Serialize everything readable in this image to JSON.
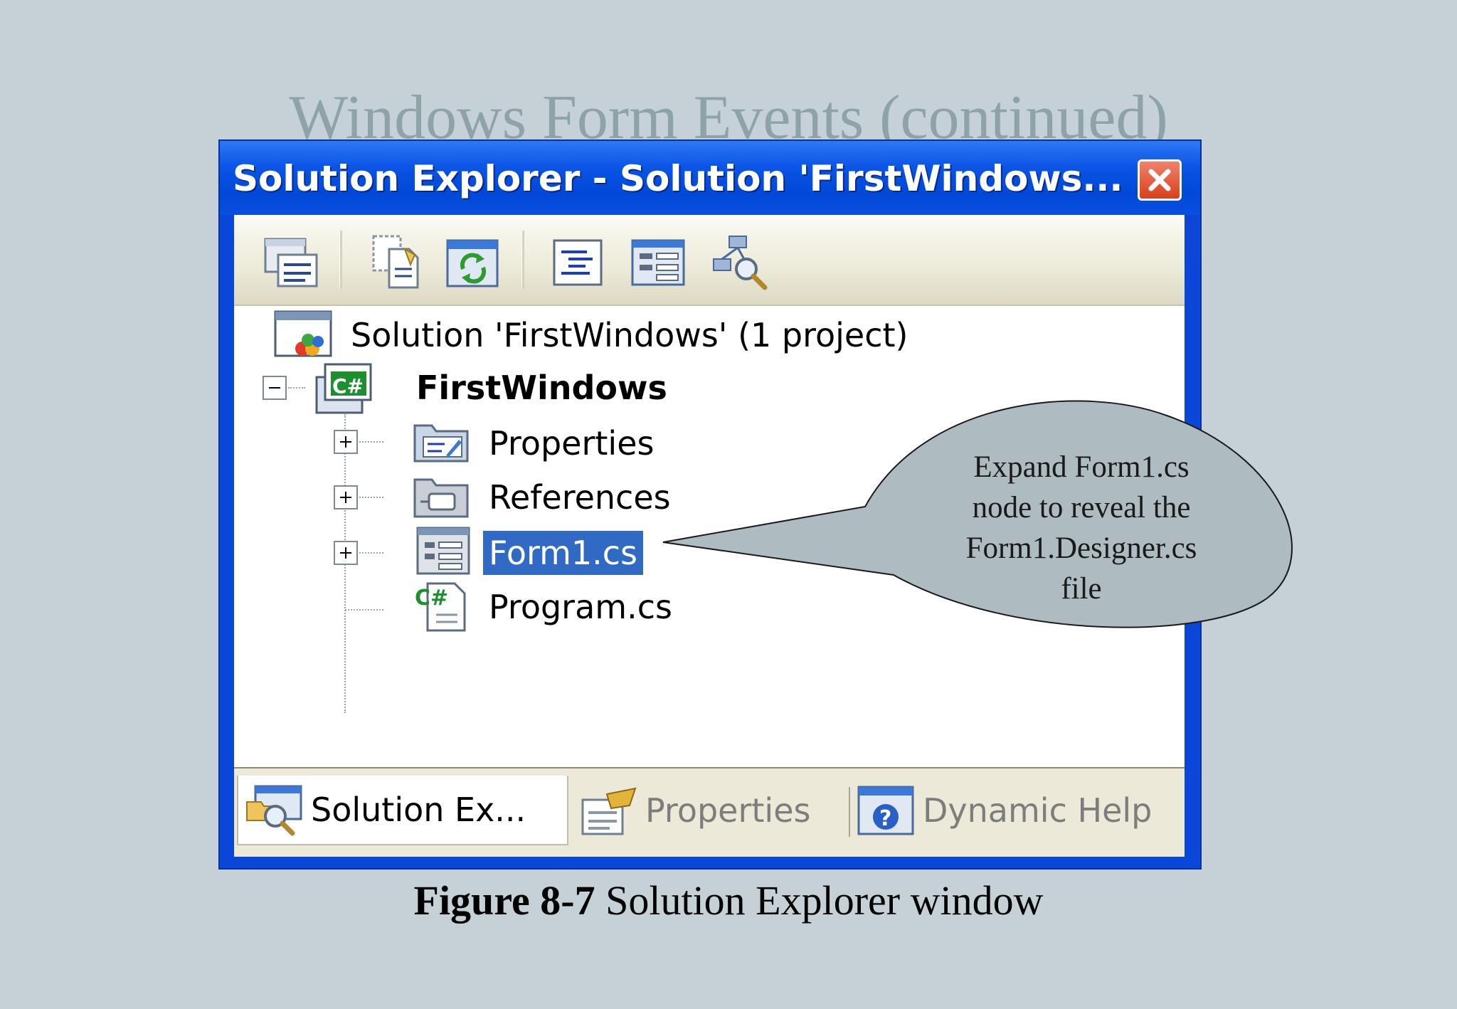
{
  "slide": {
    "title": "Windows Form Events (continued)"
  },
  "window": {
    "title": "Solution Explorer - Solution 'FirstWindows...",
    "close_icon": "close-icon",
    "accent": "#0a46d8"
  },
  "toolbar": {
    "buttons": [
      "properties-icon",
      "show-all-files-icon",
      "refresh-icon",
      "view-code-icon",
      "view-designer-icon",
      "class-diagram-icon"
    ]
  },
  "tree": {
    "solution": "Solution 'FirstWindows' (1 project)",
    "project": "FirstWindows",
    "items": [
      {
        "label": "Properties",
        "expander": "+"
      },
      {
        "label": "References",
        "expander": "+"
      },
      {
        "label": "Form1.cs",
        "expander": "+",
        "selected": true
      },
      {
        "label": "Program.cs"
      }
    ],
    "selection_color": "#316ac5"
  },
  "tabs": [
    {
      "label": "Solution Ex...",
      "active": true
    },
    {
      "label": "Properties",
      "active": false
    },
    {
      "label": "Dynamic Help",
      "active": false
    }
  ],
  "callout": {
    "lines": [
      "Expand Form1.cs",
      "node to reveal the",
      "Form1.Designer.cs",
      "file"
    ]
  },
  "caption": {
    "figure": "Figure 8-7",
    "text": " Solution Explorer window"
  }
}
